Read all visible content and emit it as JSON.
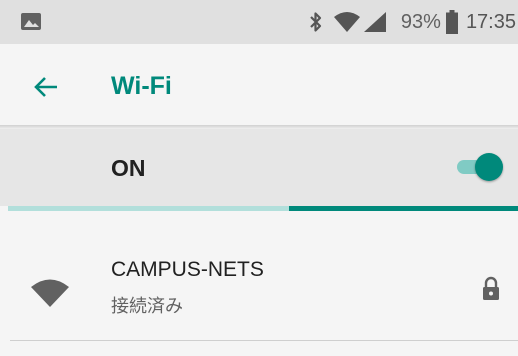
{
  "status_bar": {
    "left_icon": "image-notification-icon",
    "icons": [
      "bluetooth-icon",
      "wifi-signal-icon",
      "cell-signal-icon"
    ],
    "battery_text": "93%",
    "battery_icon": "battery-icon",
    "time": "17:35"
  },
  "app_bar": {
    "back_icon": "arrow-back-icon",
    "title": "Wi-Fi"
  },
  "master_switch": {
    "label": "ON",
    "state": "on"
  },
  "scan_progress": {
    "filled_start_fraction": 0.55,
    "filled_end_fraction": 1.0
  },
  "networks": [
    {
      "name": "CAMPUS-NETS",
      "status": "接続済み",
      "signal_icon": "wifi-signal-icon",
      "secured_icon": "lock-icon"
    }
  ],
  "colors": {
    "accent": "#00897b",
    "accent_light": "#80cbc4",
    "status_bar_bg": "#e0e0e0",
    "switch_row_bg": "#e6e6e6",
    "background": "#f5f5f5"
  }
}
